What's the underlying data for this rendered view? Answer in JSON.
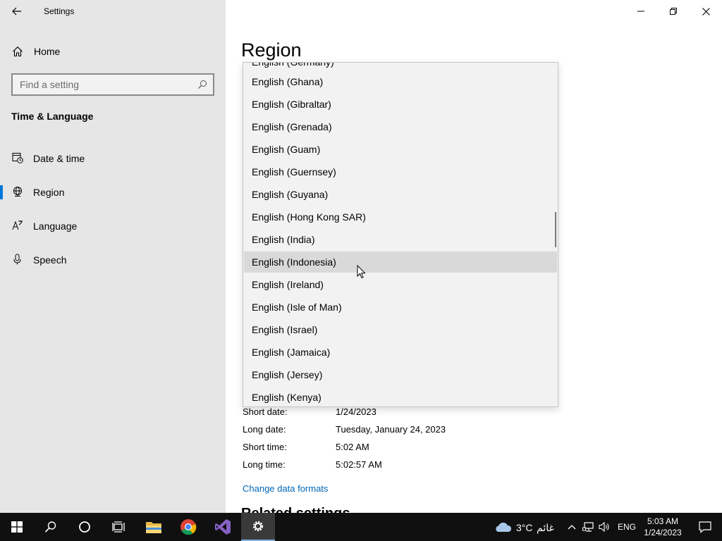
{
  "app": {
    "title": "Settings"
  },
  "sidebar": {
    "home_label": "Home",
    "search_placeholder": "Find a setting",
    "section_title": "Time & Language",
    "items": [
      {
        "label": "Date & time",
        "icon": "clock-calendar-icon",
        "selected": false
      },
      {
        "label": "Region",
        "icon": "globe-icon",
        "selected": true
      },
      {
        "label": "Language",
        "icon": "language-icon",
        "selected": false
      },
      {
        "label": "Speech",
        "icon": "microphone-icon",
        "selected": false
      }
    ]
  },
  "main": {
    "page_title": "Region",
    "formats": [
      {
        "label": "Short date:",
        "value": "1/24/2023"
      },
      {
        "label": "Long date:",
        "value": "Tuesday, January 24, 2023"
      },
      {
        "label": "Short time:",
        "value": "5:02 AM"
      },
      {
        "label": "Long time:",
        "value": "5:02:57 AM"
      }
    ],
    "change_link": "Change data formats",
    "related_heading": "Related settings"
  },
  "dropdown": {
    "hovered": "English (Indonesia)",
    "items": [
      "English (Ghana)",
      "English (Gibraltar)",
      "English (Grenada)",
      "English (Guam)",
      "English (Guernsey)",
      "English (Guyana)",
      "English (Hong Kong SAR)",
      "English (India)",
      "English (Indonesia)",
      "English (Ireland)",
      "English (Isle of Man)",
      "English (Israel)",
      "English (Jamaica)",
      "English (Jersey)",
      "English (Kenya)"
    ]
  },
  "taskbar": {
    "weather_temp": "3°C",
    "weather_desc": "غائم",
    "language": "ENG",
    "time": "5:03 AM",
    "date": "1/24/2023"
  },
  "colors": {
    "accent": "#0078d7",
    "link": "#0067b8",
    "sidebar_bg": "#e6e6e6",
    "taskbar_bg": "#101010"
  }
}
